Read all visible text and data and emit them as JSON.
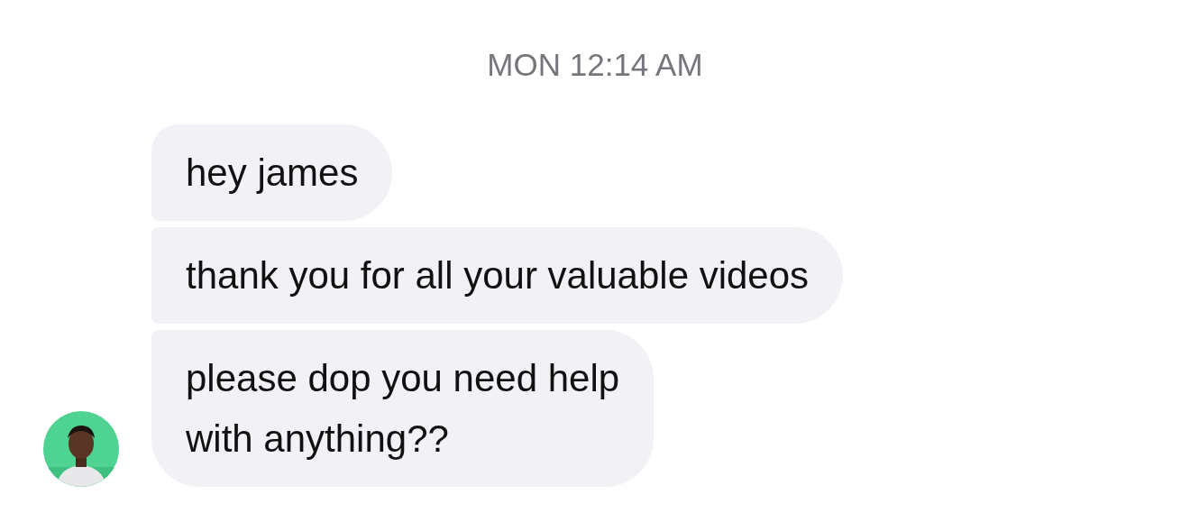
{
  "timestamp": "MON 12:14 AM",
  "messages": [
    {
      "text": "hey james"
    },
    {
      "text": "thank you for all your valuable videos"
    },
    {
      "text": "please dop you need help\nwith anything??"
    }
  ]
}
